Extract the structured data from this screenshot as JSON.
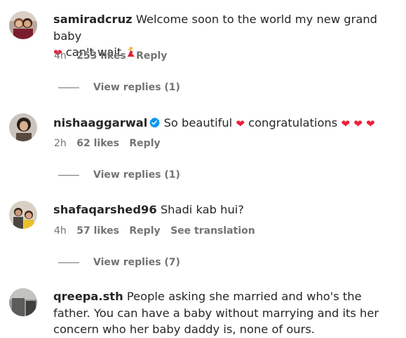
{
  "comments": [
    {
      "username": "samiradcruz",
      "text_1": "Welcome soon to the world my new grand baby",
      "text_2": "can't wait",
      "time": "4h",
      "likes": "253 likes",
      "reply": "Reply",
      "view_replies": "View replies (1)",
      "verified": false,
      "emojis": [
        "red-heart-icon",
        "dancer-icon"
      ]
    },
    {
      "username": "nishaaggarwal",
      "text_1": "So beautiful",
      "text_2": "congratulations",
      "time": "2h",
      "likes": "62 likes",
      "reply": "Reply",
      "view_replies": "View replies (1)",
      "verified": true,
      "emojis": [
        "red-heart-icon",
        "red-heart-icon",
        "red-heart-icon",
        "red-heart-icon"
      ]
    },
    {
      "username": "shafaqarshed96",
      "text_1": "Shadi kab hui?",
      "time": "4h",
      "likes": "57 likes",
      "reply": "Reply",
      "see_translation": "See translation",
      "view_replies": "View replies (7)",
      "verified": false
    },
    {
      "username": "qreepa.sth",
      "text_1": "People asking she married and who's the father. You can have a baby without marrying and its her concern who her baby daddy is, none of ours.",
      "verified": false
    }
  ],
  "colors": {
    "text": "#262626",
    "secondary": "#737373",
    "heart": "#ed1f3a",
    "verified": "#0095f6"
  }
}
